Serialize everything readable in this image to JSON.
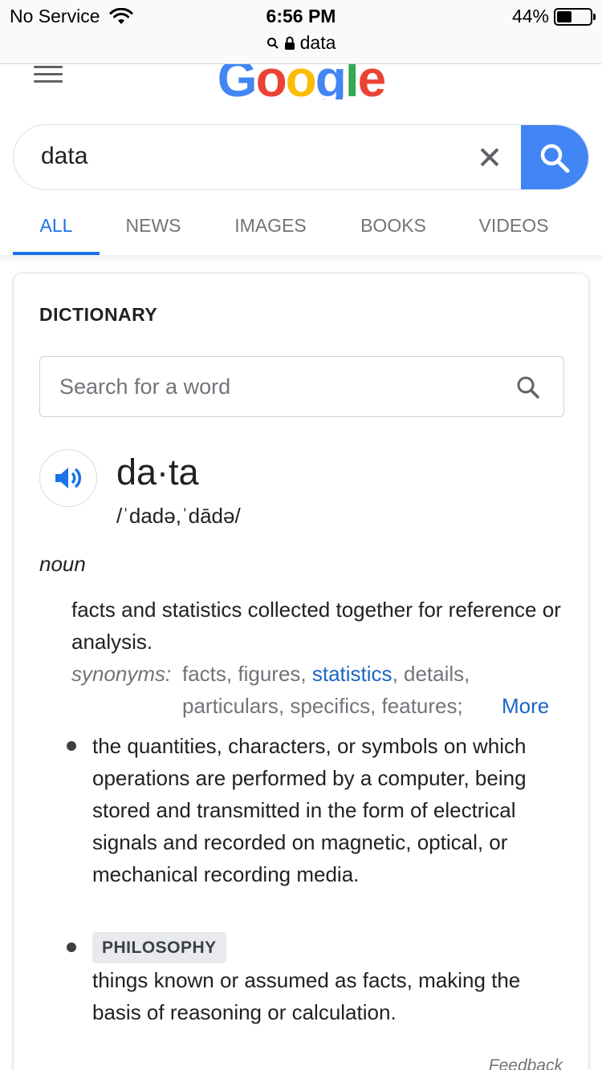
{
  "status_bar": {
    "carrier": "No Service",
    "time": "6:56 PM",
    "url": "data",
    "battery": "44%",
    "battery_level": 0.44
  },
  "header": {
    "logo": "Google"
  },
  "search": {
    "query": "data"
  },
  "tabs": [
    {
      "label": "ALL",
      "active": true
    },
    {
      "label": "NEWS",
      "active": false
    },
    {
      "label": "IMAGES",
      "active": false
    },
    {
      "label": "BOOKS",
      "active": false
    },
    {
      "label": "VIDEOS",
      "active": false
    }
  ],
  "dictionary": {
    "title": "DICTIONARY",
    "search_placeholder": "Search for a word",
    "headword": "da·ta",
    "phonetic": "/ˈdadə,ˈdādə/",
    "part_of_speech": "noun",
    "sense1": "facts and statistics collected together for reference or analysis.",
    "synonyms_label": "synonyms:",
    "synonyms": [
      "facts",
      "figures",
      "statistics",
      "details",
      "particulars",
      "specifics",
      "features"
    ],
    "synonyms_linked": "statistics",
    "more_label": "More",
    "sense2": "the quantities, characters, or symbols on which operations are performed by a computer, being stored and transmitted in the form of electrical signals and recorded on magnetic, optical, or mechanical recording media.",
    "tag": "PHILOSOPHY",
    "sense3": "things known or assumed as facts, making the basis of reasoning or calculation.",
    "feedback": "Feedback"
  },
  "colors": {
    "google_blue": "#4285f4",
    "google_red": "#ea4335",
    "google_yellow": "#fbbc05",
    "google_green": "#34a853",
    "link_blue": "#1a66c4",
    "tab_active": "#1a73e8"
  }
}
